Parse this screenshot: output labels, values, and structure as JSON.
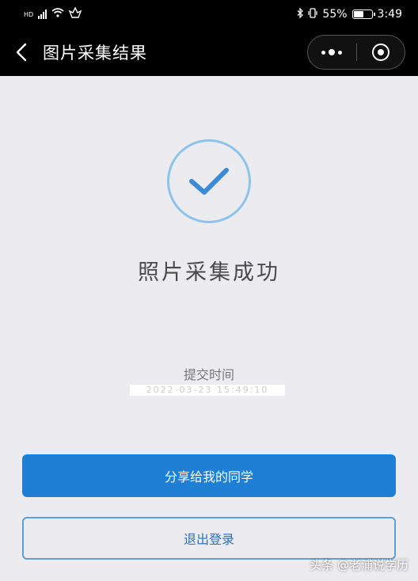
{
  "status_bar": {
    "left_label": "HD",
    "battery": "55%",
    "time": "3:49"
  },
  "nav": {
    "title": "图片采集结果"
  },
  "result": {
    "title": "照片采集成功",
    "submit_label": "提交时间",
    "submit_value": "2022-03-23 15:49:10"
  },
  "buttons": {
    "share": "分享给我的同学",
    "logout": "退出登录"
  },
  "watermark": "头条 @老浦说学历",
  "colors": {
    "accent": "#1e7fd4",
    "success_ring": "#8ec3ea"
  }
}
